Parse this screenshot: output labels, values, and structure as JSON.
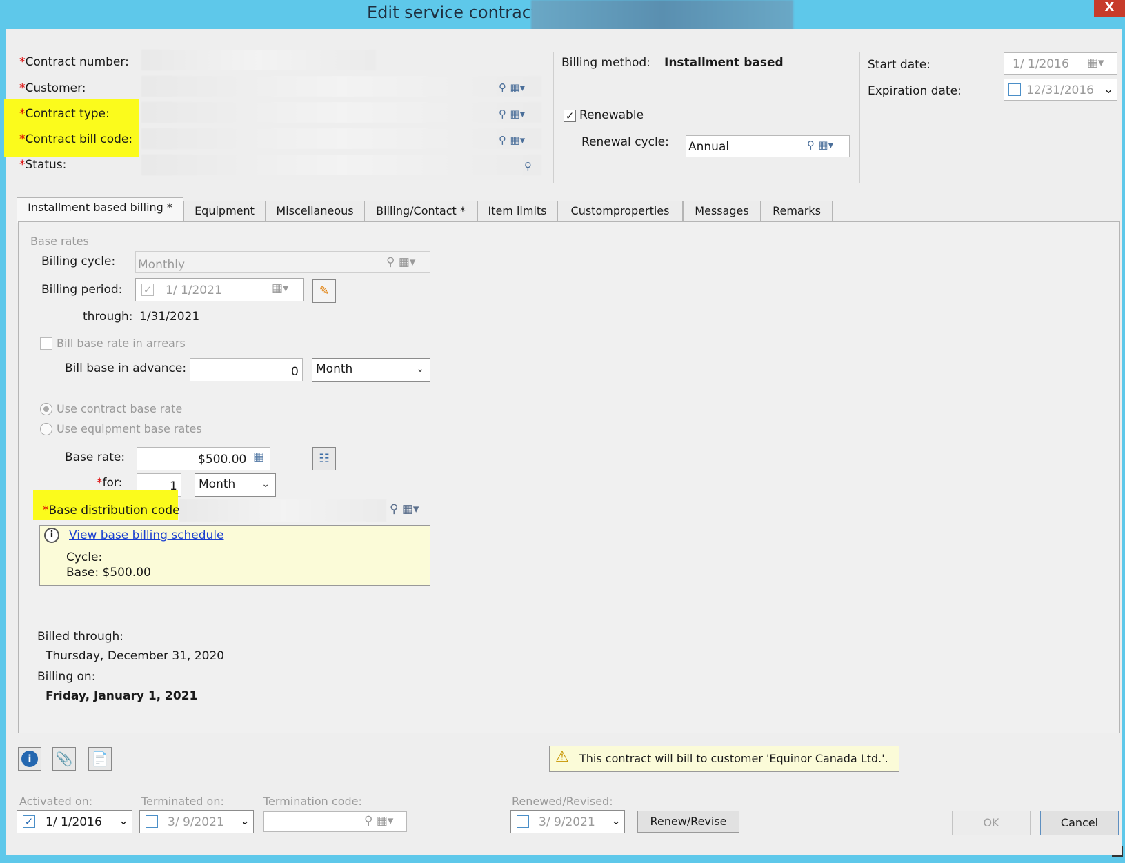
{
  "window": {
    "title": "Edit service contract -",
    "close_label": "X"
  },
  "header": {
    "required_mark": "*",
    "contract_number_label": "Contract number:",
    "customer_label": "Customer:",
    "contract_type_label": "Contract type:",
    "contract_bill_code_label": "Contract bill code:",
    "status_label": "Status:",
    "billing_method_label": "Billing method:",
    "billing_method_value": "Installment based",
    "renewable_label": "Renewable",
    "renewable_checked": "✓",
    "renewal_cycle_label": "Renewal cycle:",
    "renewal_cycle_value": "Annual",
    "start_date_label": "Start date:",
    "start_date_value": "1/ 1/2016",
    "expiration_date_label": "Expiration date:",
    "expiration_date_value": "12/31/2016"
  },
  "tabs": [
    {
      "label": "Installment based billing *"
    },
    {
      "label": "Equipment"
    },
    {
      "label": "Miscellaneous"
    },
    {
      "label": "Billing/Contact *"
    },
    {
      "label": "Item limits"
    },
    {
      "label": "Customproperties"
    },
    {
      "label": "Messages"
    },
    {
      "label": "Remarks"
    }
  ],
  "billing": {
    "base_rates_legend": "Base rates",
    "billing_cycle_label": "Billing cycle:",
    "billing_cycle_value": "Monthly",
    "billing_period_label": "Billing period:",
    "billing_period_value": "1/ 1/2021",
    "through_label": "through:",
    "through_value": "1/31/2021",
    "bill_in_arrears_label": "Bill base rate in arrears",
    "bill_in_advance_label": "Bill base in advance:",
    "bill_in_advance_value": "0",
    "bill_in_advance_unit": "Month",
    "use_contract_rate_label": "Use contract base rate",
    "use_equipment_rates_label": "Use equipment base rates",
    "base_rate_label": "Base rate:",
    "base_rate_value": "$500.00",
    "for_label": "for:",
    "for_value": "1",
    "for_unit": "Month",
    "base_distribution_label": "Base distribution code:",
    "schedule_link": "View base billing schedule",
    "cycle_label": "Cycle:",
    "base_summary": "Base: $500.00",
    "billed_through_label": "Billed through:",
    "billed_through_value": "Thursday, December 31, 2020",
    "billing_on_label": "Billing on:",
    "billing_on_value": "Friday, January 1, 2021"
  },
  "footer": {
    "warning_text": "This contract will bill to customer 'Equinor Canada Ltd.'.",
    "activated_on_label": "Activated on:",
    "activated_on_value": "1/ 1/2016",
    "terminated_on_label": "Terminated on:",
    "terminated_on_value": "3/ 9/2021",
    "termination_code_label": "Termination code:",
    "renewed_label": "Renewed/Revised:",
    "renewed_value": "3/ 9/2021",
    "renew_button": "Renew/Revise",
    "ok_button": "OK",
    "cancel_button": "Cancel"
  },
  "colors": {
    "titlebar": "#5ec8ea",
    "highlight": "#fbfb1c",
    "link": "#1a3fd0",
    "info_box": "#fbfbd8"
  }
}
